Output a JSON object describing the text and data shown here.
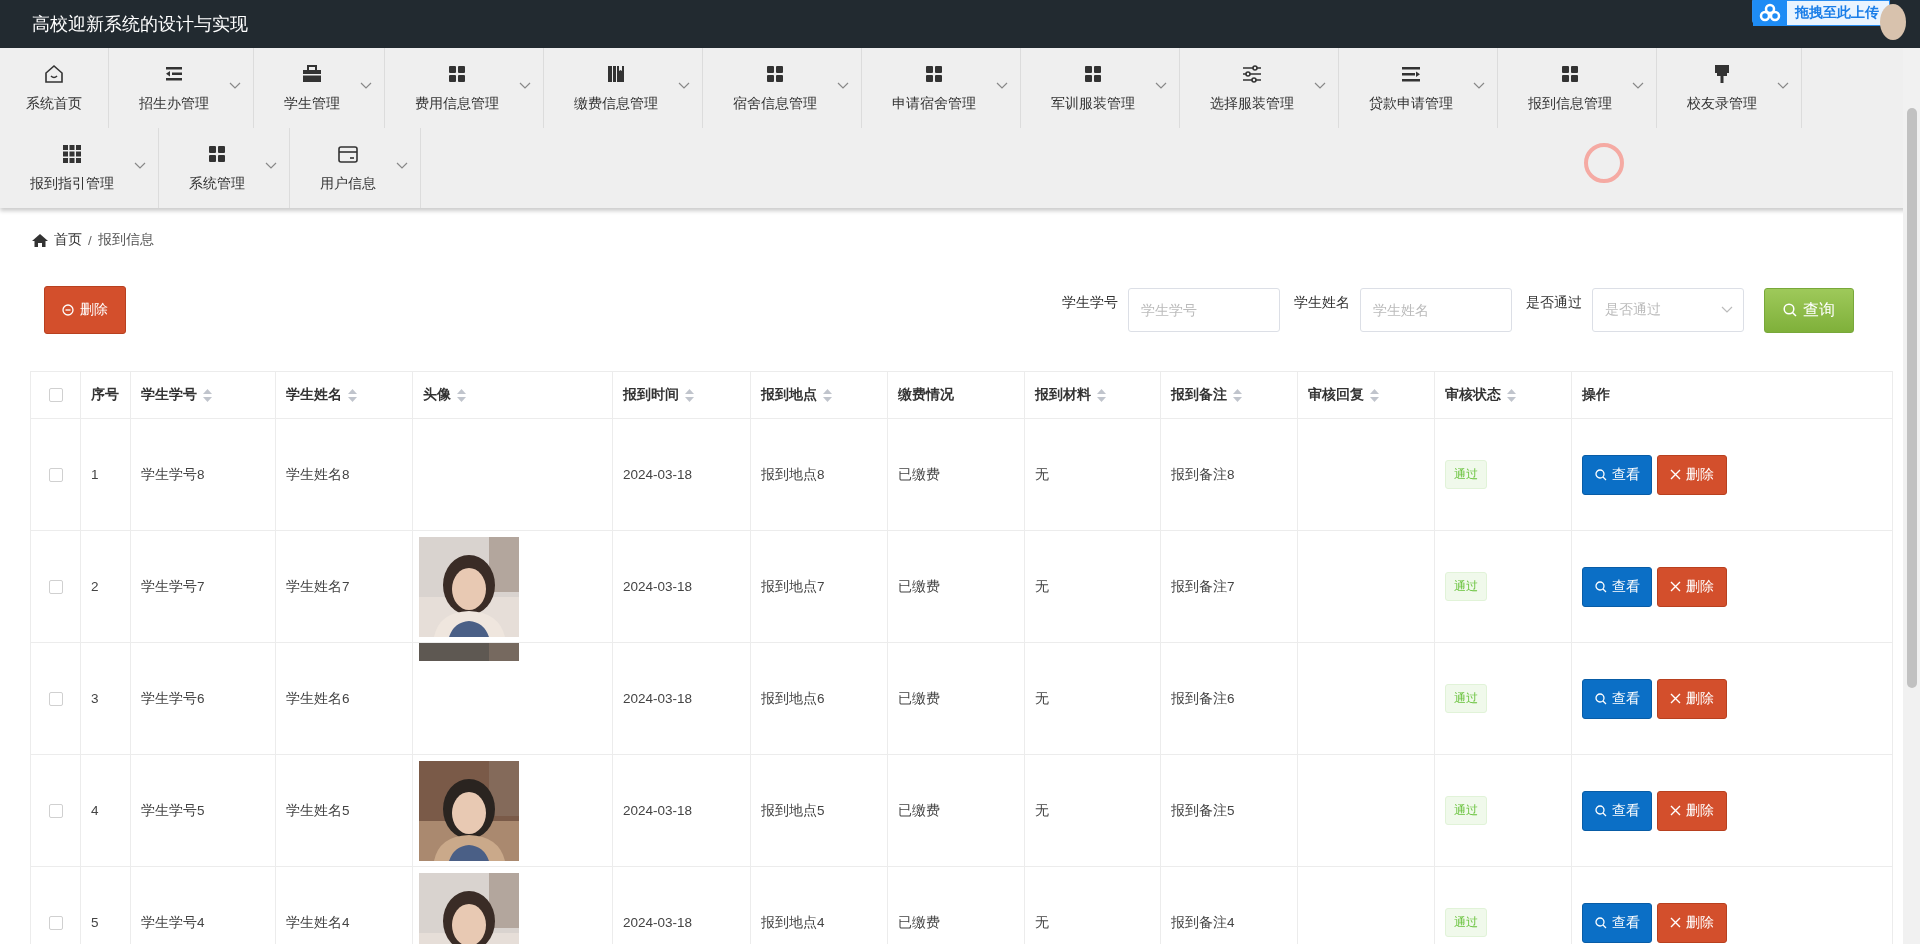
{
  "header": {
    "title": "高校迎新系统的设计与实现",
    "upload_widget": "拖拽至此上传"
  },
  "nav": [
    {
      "label": "系统首页",
      "dropdown": false
    },
    {
      "label": "招生办管理",
      "dropdown": true
    },
    {
      "label": "学生管理",
      "dropdown": true
    },
    {
      "label": "费用信息管理",
      "dropdown": true
    },
    {
      "label": "缴费信息管理",
      "dropdown": true
    },
    {
      "label": "宿舍信息管理",
      "dropdown": true
    },
    {
      "label": "申请宿舍管理",
      "dropdown": true
    },
    {
      "label": "军训服装管理",
      "dropdown": true
    },
    {
      "label": "选择服装管理",
      "dropdown": true
    },
    {
      "label": "贷款申请管理",
      "dropdown": true
    },
    {
      "label": "报到信息管理",
      "dropdown": true
    },
    {
      "label": "校友录管理",
      "dropdown": true
    },
    {
      "label": "报到指引管理",
      "dropdown": true
    },
    {
      "label": "系统管理",
      "dropdown": true
    },
    {
      "label": "用户信息",
      "dropdown": true
    }
  ],
  "breadcrumb": {
    "items": [
      "首页",
      "报到信息"
    ],
    "separator": "/"
  },
  "toolbar": {
    "delete_button": "删除",
    "filters": [
      {
        "kind": "input",
        "label": "学生学号",
        "placeholder": "学生学号"
      },
      {
        "kind": "input",
        "label": "学生姓名",
        "placeholder": "学生姓名"
      },
      {
        "kind": "select",
        "label": "是否通过",
        "placeholder": "是否通过"
      }
    ],
    "search_button": "查询"
  },
  "table": {
    "select_all_checked": false,
    "columns": [
      {
        "label": "序号",
        "sortable": false
      },
      {
        "label": "学生学号",
        "sortable": true
      },
      {
        "label": "学生姓名",
        "sortable": true
      },
      {
        "label": "头像",
        "sortable": true
      },
      {
        "label": "报到时间",
        "sortable": true
      },
      {
        "label": "报到地点",
        "sortable": true
      },
      {
        "label": "缴费情况",
        "sortable": false
      },
      {
        "label": "报到材料",
        "sortable": true
      },
      {
        "label": "报到备注",
        "sortable": true
      },
      {
        "label": "审核回复",
        "sortable": true
      },
      {
        "label": "审核状态",
        "sortable": true
      },
      {
        "label": "操作",
        "sortable": false
      }
    ],
    "rows": [
      {
        "checked": false,
        "index": "1",
        "student_no": "学生学号8",
        "name": "学生姓名8",
        "photo": false,
        "photo_cropped": false,
        "time": "2024-03-18",
        "place": "报到地点8",
        "payment": "已缴费",
        "material": "无",
        "note": "报到备注8",
        "status": "通过",
        "view": "查看",
        "delete": "删除"
      },
      {
        "checked": false,
        "index": "2",
        "student_no": "学生学号7",
        "name": "学生姓名7",
        "photo": true,
        "photo_cropped": false,
        "time": "2024-03-18",
        "place": "报到地点7",
        "payment": "已缴费",
        "material": "无",
        "note": "报到备注7",
        "status": "通过",
        "view": "查看",
        "delete": "删除"
      },
      {
        "checked": false,
        "index": "3",
        "student_no": "学生学号6",
        "name": "学生姓名6",
        "photo": true,
        "photo_cropped": true,
        "time": "2024-03-18",
        "place": "报到地点6",
        "payment": "已缴费",
        "material": "无",
        "note": "报到备注6",
        "status": "通过",
        "view": "查看",
        "delete": "删除"
      },
      {
        "checked": false,
        "index": "4",
        "student_no": "学生学号5",
        "name": "学生姓名5",
        "photo": true,
        "photo_cropped": false,
        "time": "2024-03-18",
        "place": "报到地点5",
        "payment": "已缴费",
        "material": "无",
        "note": "报到备注5",
        "status": "通过",
        "view": "查看",
        "delete": "删除"
      },
      {
        "checked": false,
        "index": "5",
        "student_no": "学生学号4",
        "name": "学生姓名4",
        "photo": true,
        "photo_cropped": false,
        "time": "2024-03-18",
        "place": "报到地点4",
        "payment": "已缴费",
        "material": "无",
        "note": "报到备注4",
        "status": "通过",
        "view": "查看",
        "delete": "删除"
      }
    ]
  }
}
